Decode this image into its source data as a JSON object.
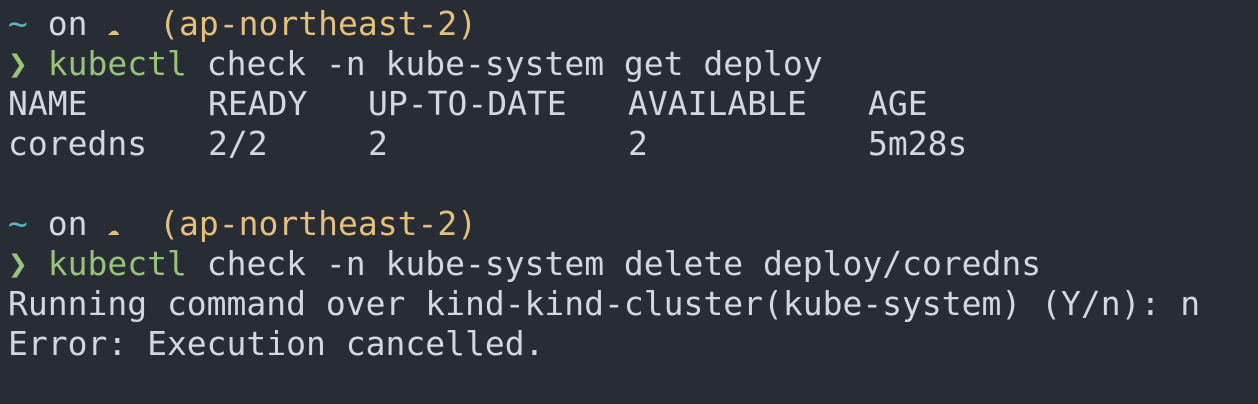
{
  "prompts": [
    {
      "tilde": "~",
      "on": "on",
      "cloud_icon": "☁",
      "region": "(ap-northeast-2)",
      "chevron": "❯",
      "command": "kubectl",
      "args": "check -n kube-system get deploy"
    },
    {
      "tilde": "~",
      "on": "on",
      "cloud_icon": "☁",
      "region": "(ap-northeast-2)",
      "chevron": "❯",
      "command": "kubectl",
      "args": "check -n kube-system delete deploy/coredns"
    }
  ],
  "table": {
    "headers": [
      "NAME",
      "READY",
      "UP-TO-DATE",
      "AVAILABLE",
      "AGE"
    ],
    "rows": [
      [
        "coredns",
        "2/2",
        "2",
        "2",
        "5m28s"
      ]
    ]
  },
  "output": {
    "confirm": "Running command over kind-kind-cluster(kube-system) (Y/n): n",
    "error": "Error: Execution cancelled."
  }
}
